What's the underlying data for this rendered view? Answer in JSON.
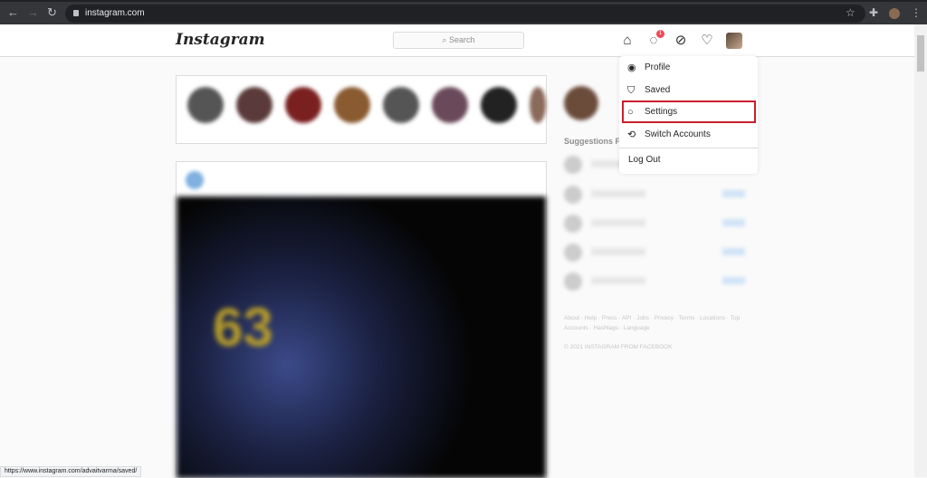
{
  "browser": {
    "url": "instagram.com",
    "status_url": "https://www.instagram.com/advaitvarma/saved/"
  },
  "header": {
    "logo": "Instagram",
    "search_placeholder": "Search",
    "messenger_badge": "1"
  },
  "sidebar": {
    "suggestions_label": "Suggestions Fo"
  },
  "footer": {
    "links": "About · Help · Press · API · Jobs · Privacy · Terms · Locations · Top Accounts · Hashtags · Language",
    "copyright": "© 2021 INSTAGRAM FROM FACEBOOK"
  },
  "menu": {
    "items": [
      {
        "label": "Profile",
        "icon": "profile-icon"
      },
      {
        "label": "Saved",
        "icon": "bookmark-icon"
      },
      {
        "label": "Settings",
        "icon": "settings-icon"
      },
      {
        "label": "Switch Accounts",
        "icon": "switch-icon"
      }
    ],
    "logout": "Log Out",
    "highlight_color": "#c8202c"
  },
  "post": {
    "jersey_number": "63"
  }
}
